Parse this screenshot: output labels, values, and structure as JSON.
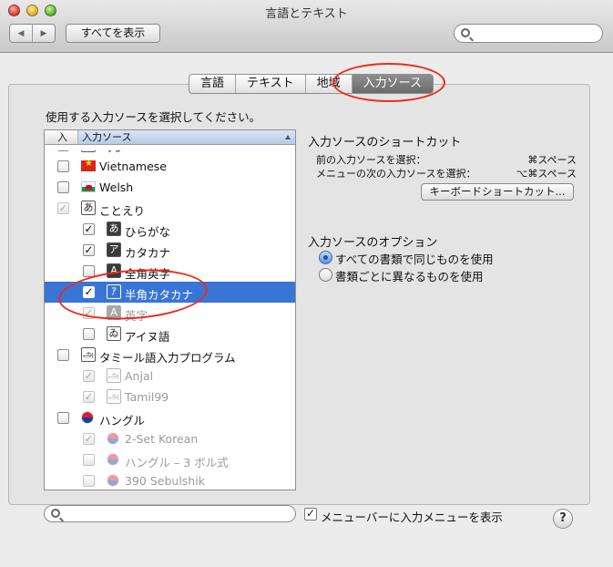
{
  "window": {
    "title": "言語とテキスト"
  },
  "toolbar": {
    "back_glyph": "◀",
    "forward_glyph": "▶",
    "show_all": "すべてを表示",
    "search_placeholder": ""
  },
  "tabs": [
    {
      "label": "言語",
      "selected": false
    },
    {
      "label": "テキスト",
      "selected": false
    },
    {
      "label": "地域",
      "selected": false
    },
    {
      "label": "入力ソース",
      "selected": true
    }
  ],
  "prompt": "使用する入力ソースを選択してください。",
  "list": {
    "header": {
      "col_on": "入",
      "col_name": "入力ソース"
    },
    "rows": [
      {
        "label": "Uyghur",
        "checked": false,
        "icon": "uyghur-icon",
        "icon_glyph": "ئ"
      },
      {
        "label": "Vietnamese",
        "checked": false,
        "icon": "vietnam-flag-icon"
      },
      {
        "label": "Welsh",
        "checked": false,
        "icon": "wales-flag-icon"
      },
      {
        "label": "ことえり",
        "checked": true,
        "dim_check": true,
        "icon": "kotoeri-icon",
        "icon_glyph": "あ"
      },
      {
        "label": "ひらがな",
        "checked": true,
        "icon": "hiragana-icon",
        "icon_glyph": "あ"
      },
      {
        "label": "カタカナ",
        "checked": true,
        "icon": "katakana-icon",
        "icon_glyph": "ア"
      },
      {
        "label": "全角英字",
        "checked": false,
        "icon": "fullwidth-roman-icon",
        "icon_glyph": "A"
      },
      {
        "label": "半角カタカナ",
        "checked": true,
        "selected": true,
        "icon": "halfwidth-katakana-icon",
        "icon_glyph": "ｱ"
      },
      {
        "label": "英字",
        "checked": true,
        "disabled": true,
        "icon": "roman-icon",
        "icon_glyph": "A"
      },
      {
        "label": "アイヌ語",
        "checked": false,
        "icon": "ainu-icon",
        "icon_glyph": "ゐ"
      },
      {
        "label": "タミール語入力プログラム",
        "checked": false,
        "icon": "tamil-input-icon",
        "icon_glyph": "அ"
      },
      {
        "label": "Anjal",
        "checked": true,
        "disabled": true,
        "icon": "anjal-icon",
        "icon_glyph": "அ"
      },
      {
        "label": "Tamil99",
        "checked": true,
        "disabled": true,
        "icon": "tamil99-icon",
        "icon_glyph": "அ"
      },
      {
        "label": "ハングル",
        "checked": false,
        "icon": "korea-flag-icon"
      },
      {
        "label": "2-Set Korean",
        "checked": true,
        "disabled": true,
        "icon": "korea-flag-icon"
      },
      {
        "label": "ハングル – 3 ボル式",
        "checked": false,
        "disabled": true,
        "icon": "korea-flag-icon"
      },
      {
        "label": "390 Sebulshik",
        "checked": false,
        "disabled": true,
        "icon": "korea-flag-icon"
      }
    ]
  },
  "shortcuts": {
    "title": "入力ソースのショートカット",
    "prev_label": "前の入力ソースを選択：",
    "prev_key": "⌘スペース",
    "next_label": "メニューの次の入力ソースを選択：",
    "next_key": "⌥⌘スペース",
    "button": "キーボードショートカット..."
  },
  "options": {
    "title": "入力ソースのオプション",
    "choices": [
      {
        "label": "すべての書類で同じものを使用",
        "selected": true
      },
      {
        "label": "書類ごとに異なるものを使用",
        "selected": false
      }
    ]
  },
  "bottom": {
    "menubar_label": "メニューバーに入力メニューを表示",
    "menubar_checked": true,
    "help": "?"
  },
  "colors": {
    "selection": "#3875d7",
    "annotation": "#ef2a1b"
  }
}
